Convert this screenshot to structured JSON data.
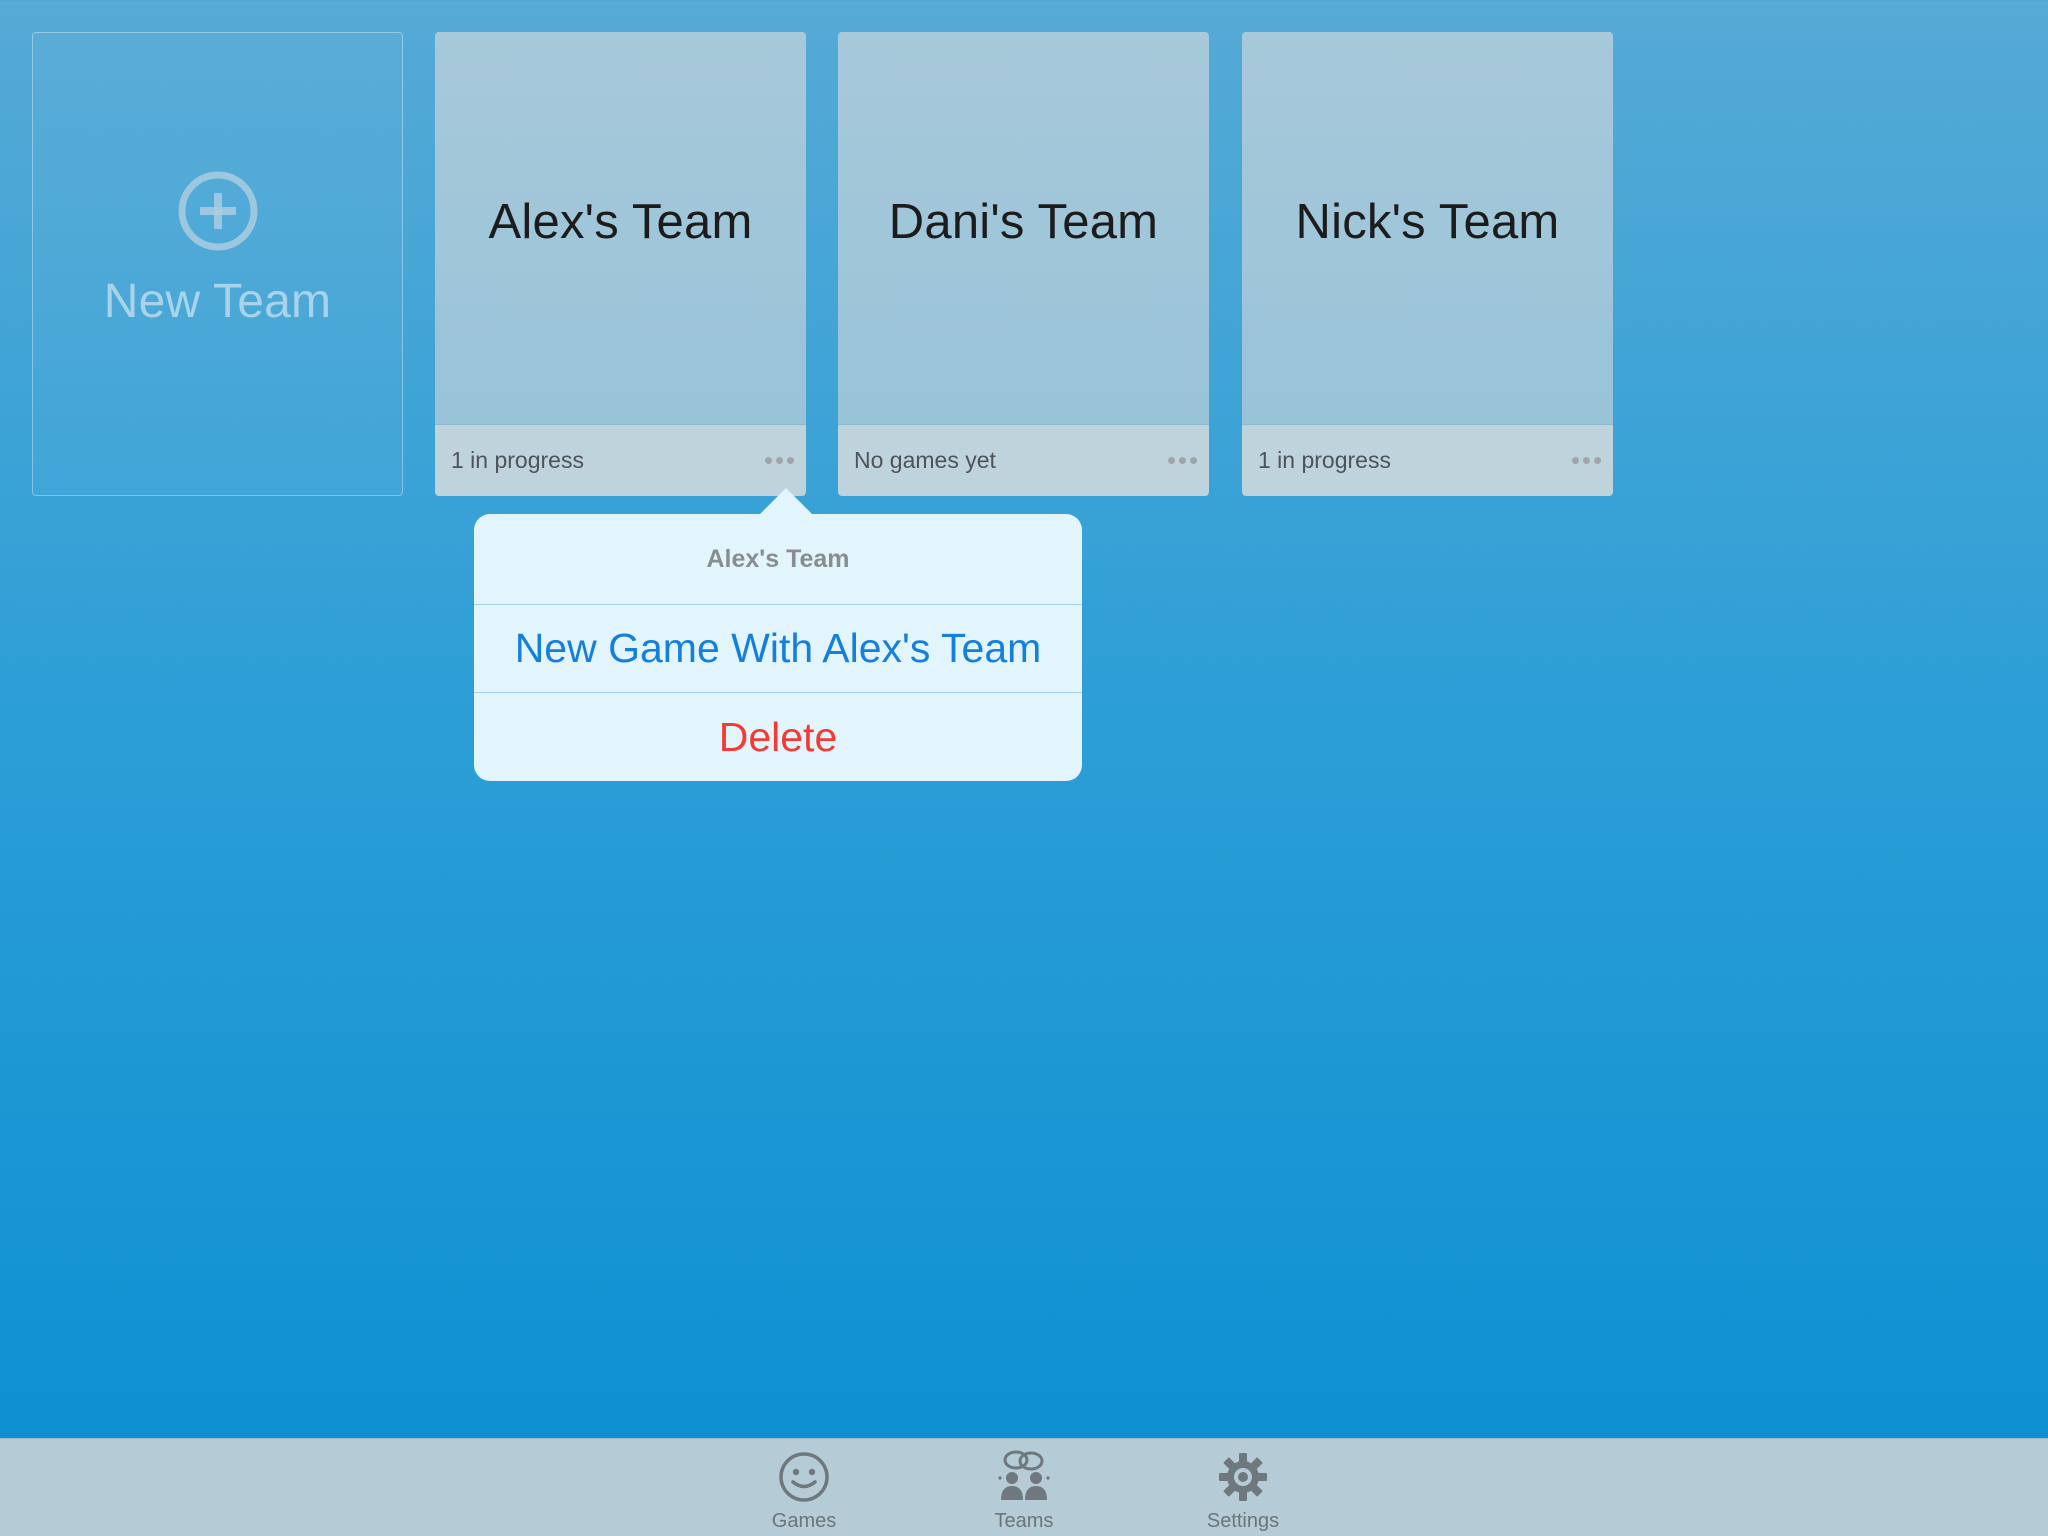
{
  "new_team": {
    "label": "New Team",
    "icon": "plus-circle-icon"
  },
  "teams": [
    {
      "name": "Alex's Team",
      "status": "1 in progress",
      "more_icon": "ellipsis-icon"
    },
    {
      "name": "Dani's Team",
      "status": "No games yet",
      "more_icon": "ellipsis-icon"
    },
    {
      "name": "Nick's Team",
      "status": "1 in progress",
      "more_icon": "ellipsis-icon"
    }
  ],
  "popover": {
    "title": "Alex's Team",
    "new_game_label": "New Game With Alex's Team",
    "delete_label": "Delete"
  },
  "tab_bar": {
    "tabs": [
      {
        "label": "Games",
        "icon": "smiley-icon"
      },
      {
        "label": "Teams",
        "icon": "people-icon"
      },
      {
        "label": "Settings",
        "icon": "gear-icon"
      }
    ]
  },
  "colors": {
    "action_blue": "#157fdc",
    "destructive_red": "#f23b36",
    "popover_bg": "#e2f4fc",
    "card_bg": "#a7c9da",
    "tab_bar_bg": "#b5cbd5"
  }
}
